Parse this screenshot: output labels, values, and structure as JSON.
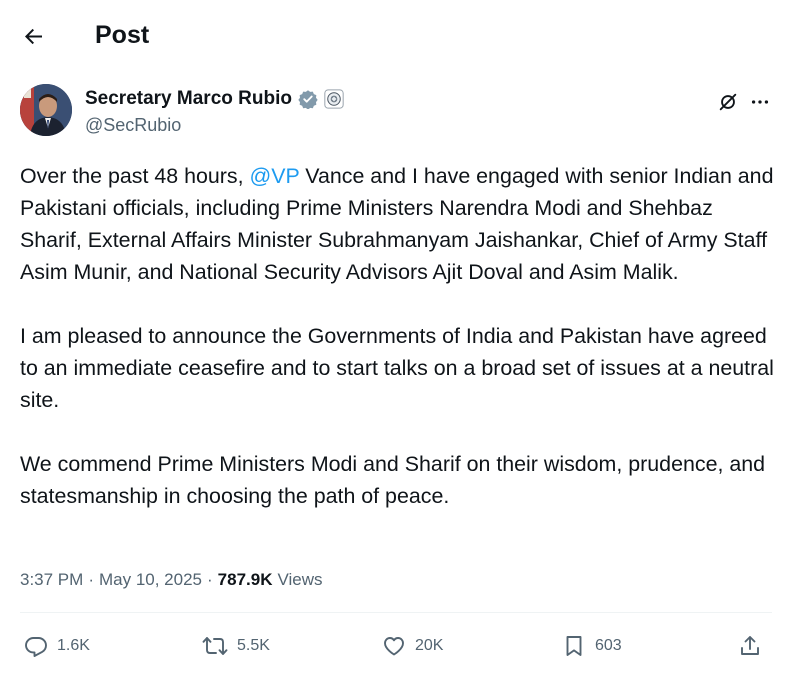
{
  "header": {
    "title": "Post",
    "back_icon": "arrow-left-icon"
  },
  "author": {
    "display_name": "Secretary Marco Rubio",
    "handle": "@SecRubio",
    "verified_badge": "verified-badge-icon",
    "affiliation_badge": "government-seal-icon",
    "colors": {
      "verified": "#829aab"
    }
  },
  "post": {
    "p1": {
      "before": "Over the past 48 hours, ",
      "mention": "@VP",
      "after": " Vance and I have engaged with senior Indian and Pakistani officials, including Prime Ministers Narendra Modi and Shehbaz Sharif, External Affairs Minister Subrahmanyam Jaishankar, Chief of Army Staff Asim Munir, and National Security Advisors Ajit Doval and Asim Malik."
    },
    "p2": "I am pleased to announce the Governments of India and Pakistan have agreed to an immediate ceasefire and to start talks on a broad set of issues at a neutral site.",
    "p3": "We commend Prime Ministers Modi and Sharif on their wisdom, prudence, and statesmanship in choosing the path of peace."
  },
  "meta": {
    "time": "3:37 PM",
    "separator": "·",
    "date": "May 10, 2025",
    "separator2": "·",
    "views_count": "787.9K",
    "views_label": "Views"
  },
  "actions": {
    "replies": "1.6K",
    "reposts": "5.5K",
    "likes": "20K",
    "bookmarks": "603"
  },
  "colors": {
    "text": "#0f1419",
    "secondary": "#536471",
    "link": "#1d9bf0",
    "divider": "#eff3f4"
  }
}
